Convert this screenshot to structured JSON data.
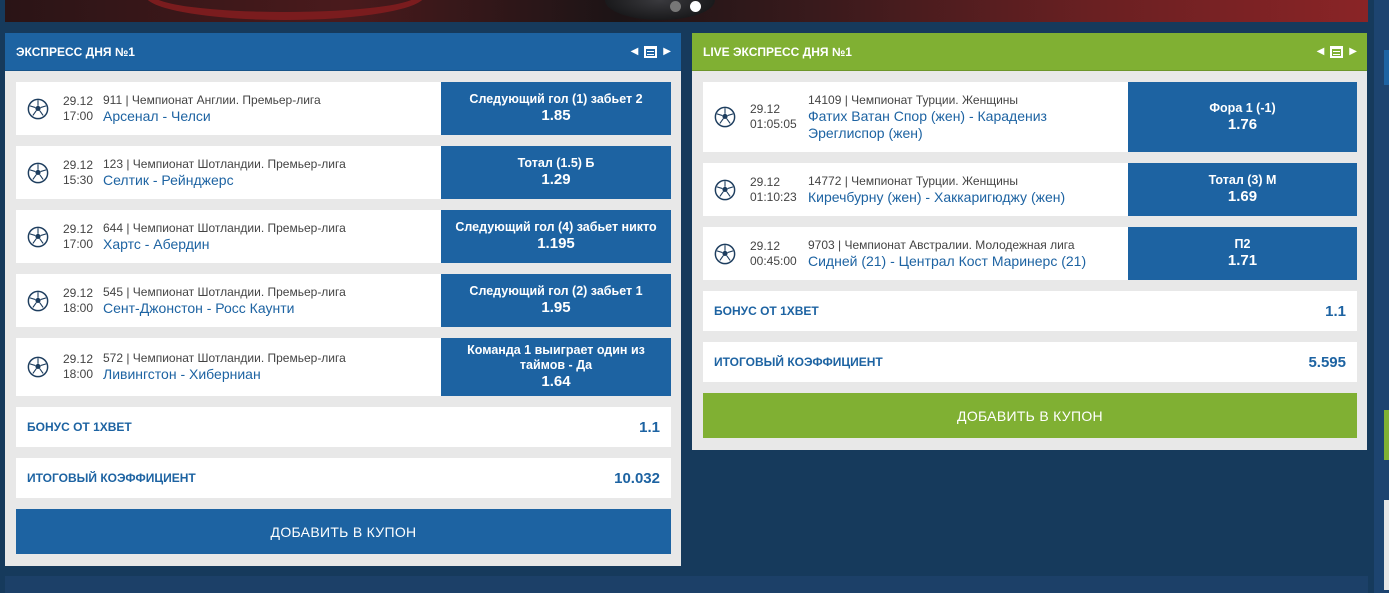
{
  "carousel": {
    "dots": 2,
    "active_index": 1
  },
  "colors": {
    "blue": "#1d63a2",
    "green": "#80b033",
    "background": "#163a5c"
  },
  "left_panel": {
    "title": "ЭКСПРЕСС ДНЯ №1",
    "icons": [
      "chevron-left-icon",
      "calendar-icon",
      "chevron-right-icon"
    ],
    "rows": [
      {
        "date": "29.12",
        "time": "17:00",
        "league": "911 | Чемпионат Англии. Премьер-лига",
        "teams": "Арсенал - Челси",
        "bet": "Следующий гол (1) забьет 2",
        "odds": "1.85"
      },
      {
        "date": "29.12",
        "time": "15:30",
        "league": "123 | Чемпионат Шотландии. Премьер-лига",
        "teams": "Селтик - Рейнджерс",
        "bet": "Тотал (1.5) Б",
        "odds": "1.29"
      },
      {
        "date": "29.12",
        "time": "17:00",
        "league": "644 | Чемпионат Шотландии. Премьер-лига",
        "teams": "Хартс - Абердин",
        "bet": "Следующий гол (4) забьет никто",
        "odds": "1.195"
      },
      {
        "date": "29.12",
        "time": "18:00",
        "league": "545 | Чемпионат Шотландии. Премьер-лига",
        "teams": "Сент-Джонстон - Росс Каунти",
        "bet": "Следующий гол (2) забьет 1",
        "odds": "1.95"
      },
      {
        "date": "29.12",
        "time": "18:00",
        "league": "572 | Чемпионат Шотландии. Премьер-лига",
        "teams": "Ливингстон - Хиберниан",
        "bet": "Команда 1 выиграет один из таймов - Да",
        "odds": "1.64"
      }
    ],
    "bonus_label": "БОНУС ОТ 1XBET",
    "bonus_value": "1.1",
    "total_label": "ИТОГОВЫЙ КОЭФФИЦИЕНТ",
    "total_value": "10.032",
    "add_button": "ДОБАВИТЬ В КУПОН"
  },
  "right_panel": {
    "title": "LIVE ЭКСПРЕСС ДНЯ №1",
    "icons": [
      "chevron-left-icon",
      "calendar-icon",
      "chevron-right-icon"
    ],
    "rows": [
      {
        "date": "29.12",
        "time": "01:05:05",
        "league": "14109 | Чемпионат Турции. Женщины",
        "teams": "Фатих Ватан Спор (жен) - Карадениз Эреглиспор (жен)",
        "bet": "Фора 1 (-1)",
        "odds": "1.76"
      },
      {
        "date": "29.12",
        "time": "01:10:23",
        "league": "14772 | Чемпионат Турции. Женщины",
        "teams": "Киречбурну (жен) - Хаккаригюджу (жен)",
        "bet": "Тотал (3) М",
        "odds": "1.69"
      },
      {
        "date": "29.12",
        "time": "00:45:00",
        "league": "9703 | Чемпионат Австралии. Молодежная лига",
        "teams": "Сидней (21) - Централ Кост Маринерс (21)",
        "bet": "П2",
        "odds": "1.71"
      }
    ],
    "bonus_label": "БОНУС ОТ 1XBET",
    "bonus_value": "1.1",
    "total_label": "ИТОГОВЫЙ КОЭФФИЦИЕНТ",
    "total_value": "5.595",
    "add_button": "ДОБАВИТЬ В КУПОН"
  }
}
